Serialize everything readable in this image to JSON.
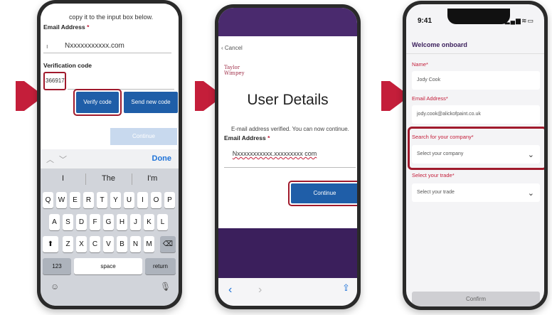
{
  "phone1": {
    "instruction_text": "copy it to the input box below.",
    "email_label": "Email Address",
    "required_mark": "*",
    "email_value": "Nxxxxxxxxxxx.com",
    "verification_label": "Verification code",
    "verification_value": "366917",
    "verify_button": "Verify code",
    "send_new_button": "Send new code",
    "continue_button": "Continue",
    "keyboard": {
      "done_label": "Done",
      "suggestions": [
        "I",
        "The",
        "I'm"
      ],
      "row1": [
        "Q",
        "W",
        "E",
        "R",
        "T",
        "Y",
        "U",
        "I",
        "O",
        "P"
      ],
      "row2": [
        "A",
        "S",
        "D",
        "F",
        "G",
        "H",
        "J",
        "K",
        "L"
      ],
      "row3": [
        "Z",
        "X",
        "C",
        "V",
        "B",
        "N",
        "M"
      ],
      "num_key": "123",
      "space_key": "space",
      "return_key": "return"
    }
  },
  "phone2": {
    "cancel_label": "Cancel",
    "logo_line1": "Taylor",
    "logo_line2": "Wimpey",
    "title": "User Details",
    "verified_message": "E-mail address verified. You can now continue.",
    "email_label": "Email Address",
    "required_mark": "*",
    "email_value": "Nxxxxxxxxxxx.xxxxxxxxx com",
    "continue_button": "Continue"
  },
  "phone3": {
    "time": "9:41",
    "welcome": "Welcome onboard",
    "name_label": "Name*",
    "name_value": "Jody Cook",
    "email_label": "Email Address*",
    "email_value": "jody.cook@alickofpaint.co.uk",
    "company_label": "Search for your company*",
    "company_placeholder": "Select your company",
    "trade_label": "Select your trade*",
    "trade_placeholder": "Select your trade",
    "confirm_button": "Confirm"
  },
  "colors": {
    "arrow_red": "#c41e3a",
    "highlight": "#a01a2c",
    "button_blue": "#1f5ea8",
    "brand_purple": "#3b1f5c"
  }
}
